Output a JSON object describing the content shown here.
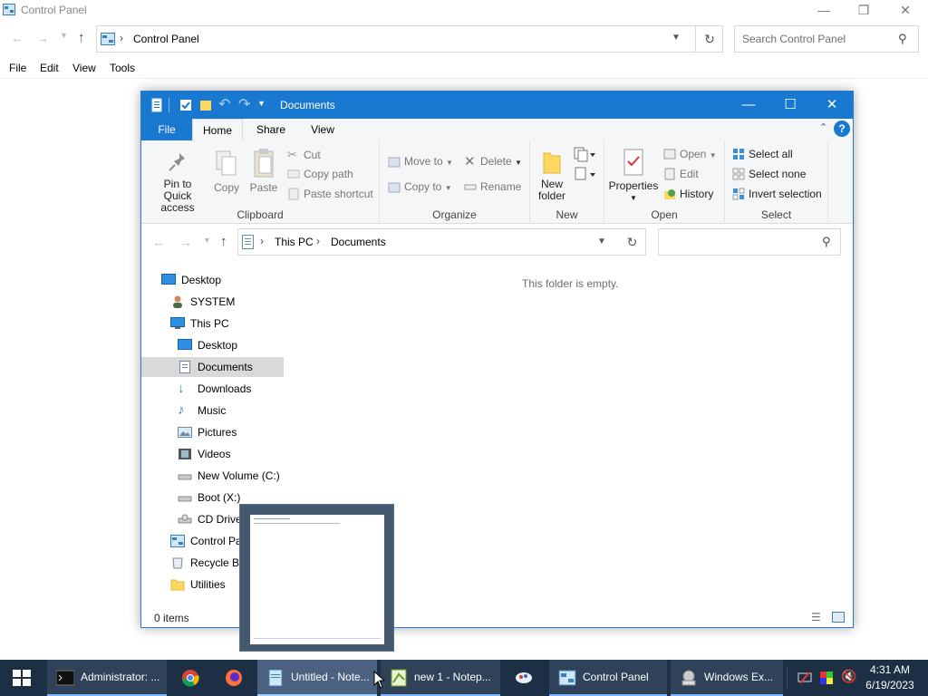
{
  "control_panel": {
    "title": "Control Panel",
    "address": "Control Panel",
    "search_placeholder": "Search Control Panel",
    "menu": [
      "File",
      "Edit",
      "View",
      "Tools"
    ]
  },
  "explorer": {
    "title": "Documents",
    "tabs": {
      "file": "File",
      "home": "Home",
      "share": "Share",
      "view": "View"
    },
    "ribbon": {
      "clipboard": {
        "label": "Clipboard",
        "pin": "Pin to Quick access",
        "copy": "Copy",
        "paste": "Paste",
        "cut": "Cut",
        "copy_path": "Copy path",
        "paste_shortcut": "Paste shortcut"
      },
      "organize": {
        "label": "Organize",
        "move_to": "Move to",
        "copy_to": "Copy to",
        "delete": "Delete",
        "rename": "Rename"
      },
      "new": {
        "label": "New",
        "new_folder": "New folder"
      },
      "open": {
        "label": "Open",
        "properties": "Properties",
        "open": "Open",
        "edit": "Edit",
        "history": "History"
      },
      "select": {
        "label": "Select",
        "select_all": "Select all",
        "select_none": "Select none",
        "invert": "Invert selection"
      }
    },
    "breadcrumb": [
      "This PC",
      "Documents"
    ],
    "tree": [
      {
        "label": "Desktop",
        "icon": "desktop-icon"
      },
      {
        "label": "SYSTEM",
        "icon": "user-icon"
      },
      {
        "label": "This PC",
        "icon": "computer-icon"
      },
      {
        "label": "Desktop",
        "icon": "desktop-icon"
      },
      {
        "label": "Documents",
        "icon": "documents-icon"
      },
      {
        "label": "Downloads",
        "icon": "downloads-icon"
      },
      {
        "label": "Music",
        "icon": "music-icon"
      },
      {
        "label": "Pictures",
        "icon": "pictures-icon"
      },
      {
        "label": "Videos",
        "icon": "videos-icon"
      },
      {
        "label": "New Volume (C:)",
        "icon": "drive-icon"
      },
      {
        "label": "Boot (X:)",
        "icon": "drive-icon"
      },
      {
        "label": "CD Drive",
        "icon": "cd-drive-icon"
      },
      {
        "label": "Control Pa",
        "icon": "control-panel-icon"
      },
      {
        "label": "Recycle Bi",
        "icon": "recycle-bin-icon"
      },
      {
        "label": "Utilities",
        "icon": "folder-icon"
      }
    ],
    "empty_message": "This folder is empty.",
    "status": "0 items"
  },
  "taskbar": {
    "items": [
      {
        "label": "Administrator: ..."
      },
      {
        "label": "Untitled - Note..."
      },
      {
        "label": "new 1 - Notep..."
      },
      {
        "label": "Control Panel"
      },
      {
        "label": "Windows Ex..."
      }
    ],
    "time": "4:31 AM",
    "date": "6/19/2023"
  },
  "colors": {
    "titlebar": "#1979d0",
    "taskbar": "#1c2f45",
    "selection": "#d9d9d9"
  }
}
